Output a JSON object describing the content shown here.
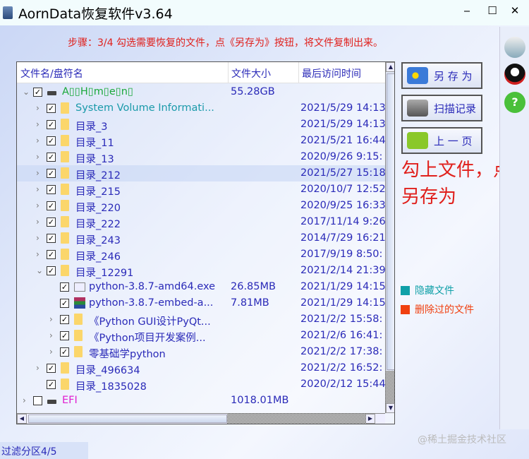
{
  "window": {
    "title": "AornData恢复软件v3.64",
    "minimize": "‒",
    "maximize": "☐",
    "close": "✕"
  },
  "step_text": "步骤：3/4 勾选需要恢复的文件，点《另存为》按钮，将文件复制出来。",
  "columns": [
    "文件名/盘符名",
    "文件大小",
    "最后访问时间"
  ],
  "rows": [
    {
      "level": 0,
      "expand": "open",
      "checked": true,
      "icon": "drive",
      "name": "A▯▯H▯m▯e▯n▯",
      "size": "55.28GB",
      "date": "",
      "color": "#1aa83a"
    },
    {
      "level": 1,
      "expand": "closed",
      "checked": true,
      "icon": "folder",
      "name": "System Volume Informati...",
      "size": "",
      "date": "2021/5/29 14:13",
      "color": "#1a9aaa"
    },
    {
      "level": 1,
      "expand": "closed",
      "checked": true,
      "icon": "folder",
      "name": "目录_3",
      "size": "",
      "date": "2021/5/29 14:13"
    },
    {
      "level": 1,
      "expand": "closed",
      "checked": true,
      "icon": "folder",
      "name": "目录_11",
      "size": "",
      "date": "2021/5/21 16:44"
    },
    {
      "level": 1,
      "expand": "closed",
      "checked": true,
      "icon": "folder",
      "name": "目录_13",
      "size": "",
      "date": "2020/9/26 9:15:"
    },
    {
      "level": 1,
      "expand": "closed",
      "checked": true,
      "icon": "folder",
      "name": "目录_212",
      "size": "",
      "date": "2021/5/27 15:18",
      "selected": true
    },
    {
      "level": 1,
      "expand": "closed",
      "checked": true,
      "icon": "folder",
      "name": "目录_215",
      "size": "",
      "date": "2020/10/7 12:52"
    },
    {
      "level": 1,
      "expand": "closed",
      "checked": true,
      "icon": "folder",
      "name": "目录_220",
      "size": "",
      "date": "2020/9/25 16:33"
    },
    {
      "level": 1,
      "expand": "closed",
      "checked": true,
      "icon": "folder",
      "name": "目录_222",
      "size": "",
      "date": "2017/11/14 9:26"
    },
    {
      "level": 1,
      "expand": "closed",
      "checked": true,
      "icon": "folder",
      "name": "目录_243",
      "size": "",
      "date": "2014/7/29 16:21"
    },
    {
      "level": 1,
      "expand": "closed",
      "checked": true,
      "icon": "folder",
      "name": "目录_246",
      "size": "",
      "date": "2017/9/19 8:50:"
    },
    {
      "level": 1,
      "expand": "open",
      "checked": true,
      "icon": "folder",
      "name": "目录_12291",
      "size": "",
      "date": "2021/2/14 21:39"
    },
    {
      "level": 2,
      "expand": "",
      "checked": true,
      "icon": "exe",
      "name": "python-3.8.7-amd64.exe",
      "size": "26.85MB",
      "date": "2021/1/29 14:15"
    },
    {
      "level": 2,
      "expand": "",
      "checked": true,
      "icon": "rar",
      "name": "python-3.8.7-embed-a...",
      "size": "7.81MB",
      "date": "2021/1/29 14:15"
    },
    {
      "level": 2,
      "expand": "closed",
      "checked": true,
      "icon": "folder",
      "name": "《Python GUI设计PyQt...",
      "size": "",
      "date": "2021/2/2 15:58:"
    },
    {
      "level": 2,
      "expand": "closed",
      "checked": true,
      "icon": "folder",
      "name": "《Python项目开发案例...",
      "size": "",
      "date": "2021/2/6 16:41:"
    },
    {
      "level": 2,
      "expand": "closed",
      "checked": true,
      "icon": "folder",
      "name": "零基础学python",
      "size": "",
      "date": "2021/2/2 17:38:"
    },
    {
      "level": 1,
      "expand": "closed",
      "checked": true,
      "icon": "folder",
      "name": "目录_496634",
      "size": "",
      "date": "2021/2/2 16:52:"
    },
    {
      "level": 1,
      "expand": "",
      "checked": true,
      "icon": "folder",
      "name": "目录_1835028",
      "size": "",
      "date": "2020/2/12 15:44"
    },
    {
      "level": 0,
      "expand": "closed",
      "checked": false,
      "icon": "drive",
      "name": "EFI",
      "size": "1018.01MB",
      "date": "",
      "color": "#e020d0"
    }
  ],
  "buttons": {
    "save_as": "另 存 为",
    "scan_record": "扫描记录",
    "prev_page": "上 一 页"
  },
  "hint": "勾上文件，点另存为",
  "legend": [
    {
      "label": "隐藏文件",
      "color": "#10a0a8"
    },
    {
      "label": "删除过的文件",
      "color": "#f04010"
    }
  ],
  "status": "过滤分区4/5",
  "watermark": "@稀土掘金技术社区"
}
